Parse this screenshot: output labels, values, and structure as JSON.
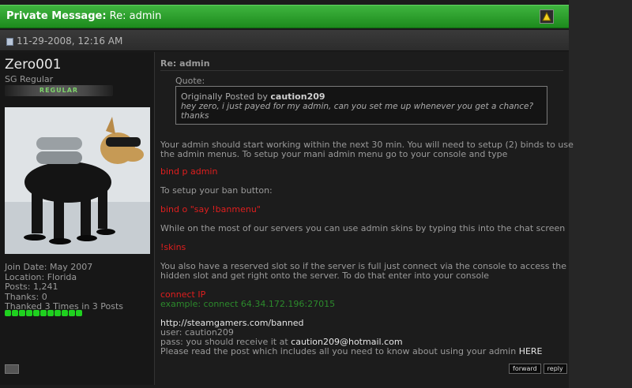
{
  "header": {
    "title_prefix": "Private Message:",
    "title_subject": "Re: admin",
    "collapse_icon": "collapse-up-icon"
  },
  "post": {
    "date": "11-29-2008, 12:16 AM"
  },
  "user": {
    "name": "Zero001",
    "title": "SG Regular",
    "rank": "REGULAR",
    "join_date": "Join Date: May 2007",
    "location": "Location: Florida",
    "posts": "Posts: 1,241",
    "thanks": "Thanks: 0",
    "thanked": "Thanked 3 Times in 3 Posts"
  },
  "message": {
    "title": "Re: admin",
    "quote_label": "Quote:",
    "quote_by_prefix": "Originally Posted by",
    "quote_author": "caution209",
    "quote_text": "hey zero, i just payed for my admin, can you set me up whenever you get a chance? thanks",
    "p1": "Your admin should start working within the next 30 min. You will need to setup (2) binds to use",
    "p1b": "the admin menus. To setup your mani admin menu go to your console and type",
    "cmd1": "bind p admin",
    "p2": "To setup your ban button:",
    "cmd2": "bind o \"say !banmenu\"",
    "p3": "While on the most of our servers you can use admin skins by typing this into the chat screen",
    "cmd3": "!skins",
    "p4": "You also have a reserved slot so if the server is full just connect via the console to access the",
    "p4b": "hidden slot and get right onto the server. To do that enter into your console",
    "cmd4": "connect IP",
    "example": "example: connect 64.34.172.196:27015",
    "url": "http://steamgamers.com/banned",
    "user_line": "user: caution209",
    "pass_prefix": "pass: you should receive it at",
    "email": "caution209@hotmail.com",
    "final_prefix": "Please read the post which includes all you need to know about using your admin",
    "final_link": "HERE"
  },
  "buttons": {
    "forward": "forward",
    "reply": "reply"
  }
}
